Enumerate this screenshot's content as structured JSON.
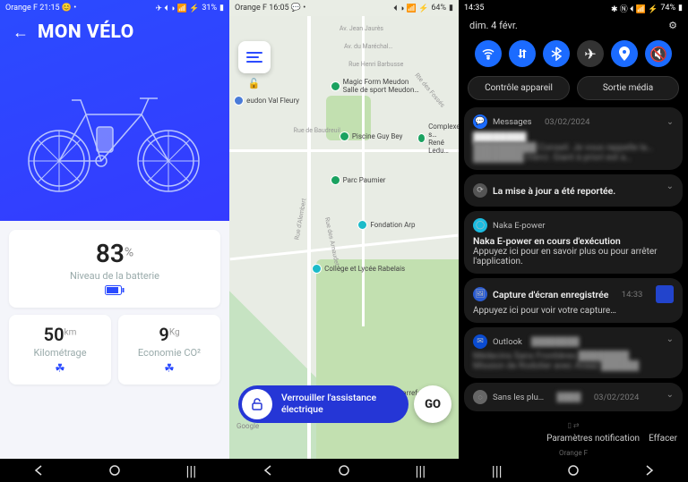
{
  "phone1": {
    "status": {
      "carrier": "Orange F",
      "time": "21:15",
      "battery": "31%"
    },
    "title": "MON VÉLO",
    "battery": {
      "value": "83",
      "unit": "%",
      "label": "Niveau de la batterie"
    },
    "mileage": {
      "value": "50",
      "unit": "km",
      "label": "Kilométrage"
    },
    "co2": {
      "value": "9",
      "unit": "Kg",
      "label": "Economie CO²"
    }
  },
  "phone2": {
    "status": {
      "carrier": "Orange F",
      "time": "16:05",
      "battery": "64%"
    },
    "pois": {
      "magicform": "Magic Form Meudon\nSalle de sport Meudon…",
      "piscine": "Piscine Guy Bey",
      "complexe": "Complexe s…\nRené Ledu…",
      "paumier": "Parc Paumier",
      "arp": "Fondation Arp",
      "college": "Collège et Lycée Rabelais",
      "carrefour": "Carrefour du…",
      "station": "eudon Val Fleury"
    },
    "roads": {
      "jaures": "Av. Jean Jaurès",
      "marechal": "Av. du Maréchal…",
      "barbusse": "Rue Henri Barbusse",
      "baudreuil": "Rue de Baudreuil",
      "fosses": "Rte des Fossés",
      "alembert": "Rue d'Alembert",
      "arnaudet": "Rue des Arnaudet"
    },
    "lock_label": "Verrouiller l'assistance électrique",
    "go_label": "GO",
    "google": "Google"
  },
  "phone3": {
    "status": {
      "time": "14:35",
      "battery": "74%"
    },
    "date": "dim. 4 févr.",
    "device_control": "Contrôle appareil",
    "media_output": "Sortie média",
    "notifs": [
      {
        "app": "Messages",
        "time": "03/02/2024",
        "color": "#1b6bff",
        "title_blur": "████████",
        "body_blur": "██████████ Conseil. Je vous rappelle la… ████████ merci. Giant à priori est a…"
      },
      {
        "app": "",
        "color": "#555",
        "title": "La mise à jour a été reportée."
      },
      {
        "app": "Naka E-power",
        "color": "#1bbbe0",
        "title": "Naka E-power en cours d'exécution",
        "body": "Appuyez ici pour en savoir plus ou pour arrêter l'application."
      },
      {
        "app": "",
        "color": "#2a5bd0",
        "title": "Capture d'écran enregistrée",
        "time": "14:33",
        "body": "Appuyez ici pour voir votre capture…"
      },
      {
        "app": "Outlook",
        "color": "#0a4bd0",
        "title_blur": "████████████",
        "body_blur": "Médecins Sans Frontières ████████\nMission de Rodolier avec Avaaz ██████"
      },
      {
        "app": "Sans les plu…",
        "color": "#666",
        "time": "03/02/2024",
        "title_blur": "████"
      }
    ],
    "settings_btn": "Paramètres notification",
    "clear_btn": "Effacer",
    "carrier": "Orange F"
  }
}
